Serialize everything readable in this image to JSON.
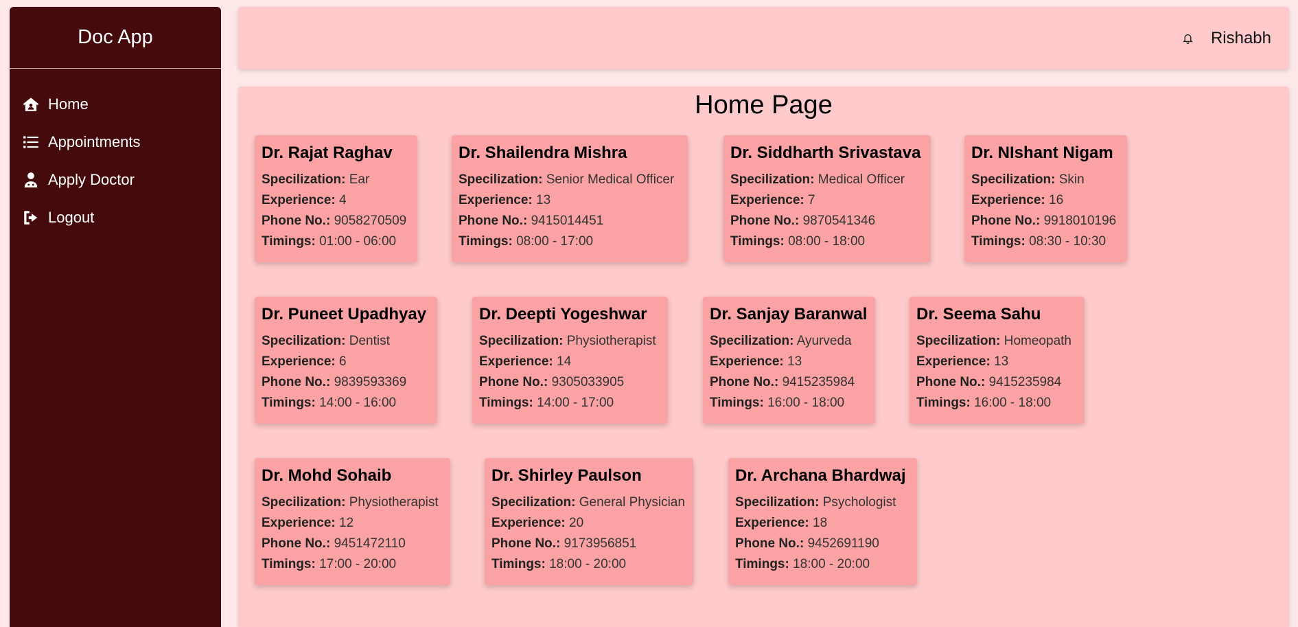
{
  "app": {
    "brand": "Doc App"
  },
  "sidebar": {
    "items": [
      {
        "label": "Home",
        "icon": "home-icon"
      },
      {
        "label": "Appointments",
        "icon": "list-icon"
      },
      {
        "label": "Apply Doctor",
        "icon": "user-doctor-icon"
      },
      {
        "label": "Logout",
        "icon": "logout-icon"
      }
    ]
  },
  "header": {
    "user": "Rishabh",
    "icon": "bell-icon"
  },
  "main": {
    "title": "Home Page"
  },
  "labels": {
    "specialization": "Specilization:",
    "experience": "Experience:",
    "phone": "Phone No.:",
    "timings": "Timings:"
  },
  "doctors": [
    {
      "name": "Dr. Rajat Raghav",
      "specialization": "Ear",
      "experience": "4",
      "phone": "9058270509",
      "timings": "01:00 - 06:00"
    },
    {
      "name": "Dr. Shailendra Mishra",
      "specialization": "Senior Medical Officer",
      "experience": "13",
      "phone": "9415014451",
      "timings": "08:00 - 17:00"
    },
    {
      "name": "Dr. Siddharth Srivastava",
      "specialization": "Medical Officer",
      "experience": "7",
      "phone": "9870541346",
      "timings": "08:00 - 18:00"
    },
    {
      "name": "Dr. NIshant Nigam",
      "specialization": "Skin",
      "experience": "16",
      "phone": "9918010196",
      "timings": "08:30 - 10:30"
    },
    {
      "name": "Dr. Puneet Upadhyay",
      "specialization": "Dentist",
      "experience": "6",
      "phone": "9839593369",
      "timings": "14:00 - 16:00"
    },
    {
      "name": "Dr. Deepti Yogeshwar",
      "specialization": "Physiotherapist",
      "experience": "14",
      "phone": "9305033905",
      "timings": "14:00 - 17:00"
    },
    {
      "name": "Dr. Sanjay Baranwal",
      "specialization": "Ayurveda",
      "experience": "13",
      "phone": "9415235984",
      "timings": "16:00 - 18:00"
    },
    {
      "name": "Dr. Seema Sahu",
      "specialization": "Homeopath",
      "experience": "13",
      "phone": "9415235984",
      "timings": "16:00 - 18:00"
    },
    {
      "name": "Dr. Mohd Sohaib",
      "specialization": "Physiotherapist",
      "experience": "12",
      "phone": "9451472110",
      "timings": "17:00 - 20:00"
    },
    {
      "name": "Dr. Shirley Paulson",
      "specialization": "General Physician",
      "experience": "20",
      "phone": "9173956851",
      "timings": "18:00 - 20:00"
    },
    {
      "name": "Dr. Archana Bhardwaj",
      "specialization": "Psychologist",
      "experience": "18",
      "phone": "9452691190",
      "timings": "18:00 - 20:00"
    }
  ],
  "colors": {
    "sidebar_bg": "#450b0c",
    "page_bg": "#fde7e7",
    "panel_bg": "#fecacb",
    "card_bg": "#fba3a4"
  }
}
